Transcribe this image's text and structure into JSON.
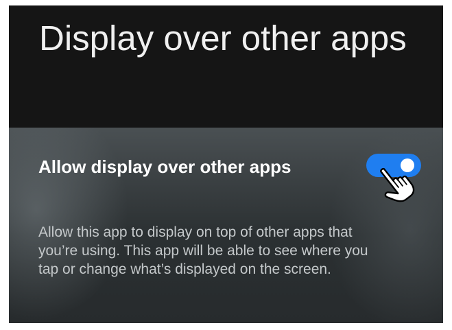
{
  "header": {
    "title": "Display over other apps"
  },
  "setting": {
    "title": "Allow display over other apps",
    "toggle_on": true,
    "description": "Allow this app to display on top of other apps that you’re using. This app will be able to see where you tap or change what’s displayed on the screen."
  },
  "colors": {
    "toggle_accent": "#1f7ef0",
    "header_bg": "#151515"
  },
  "icons": {
    "pointer": "hand-pointer-icon"
  }
}
